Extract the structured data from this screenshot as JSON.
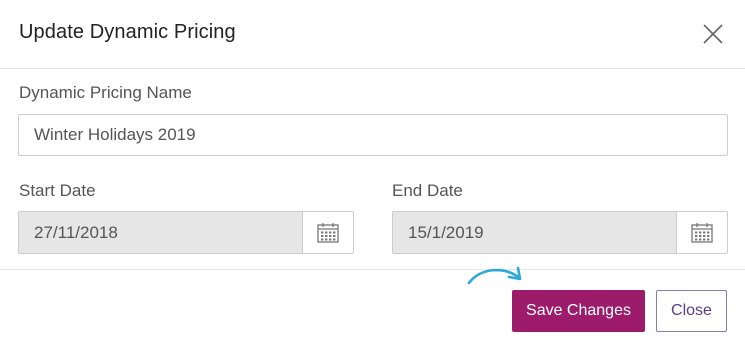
{
  "dialog": {
    "title": "Update Dynamic Pricing",
    "close_icon": "close-icon"
  },
  "form": {
    "name_label": "Dynamic Pricing Name",
    "name_value": "Winter Holidays 2019",
    "start_label": "Start Date",
    "start_value": "27/11/2018",
    "end_label": "End Date",
    "end_value": "15/1/2019",
    "calendar_icon": "calendar-icon"
  },
  "footer": {
    "save_label": "Save Changes",
    "close_label": "Close",
    "hint_icon": "curved-arrow-icon"
  },
  "colors": {
    "accent": "#9c1b6a",
    "secondary_text": "#5a3c8c",
    "secondary_border": "#8a7bb0",
    "hint_arrow": "#2ba8d9"
  }
}
